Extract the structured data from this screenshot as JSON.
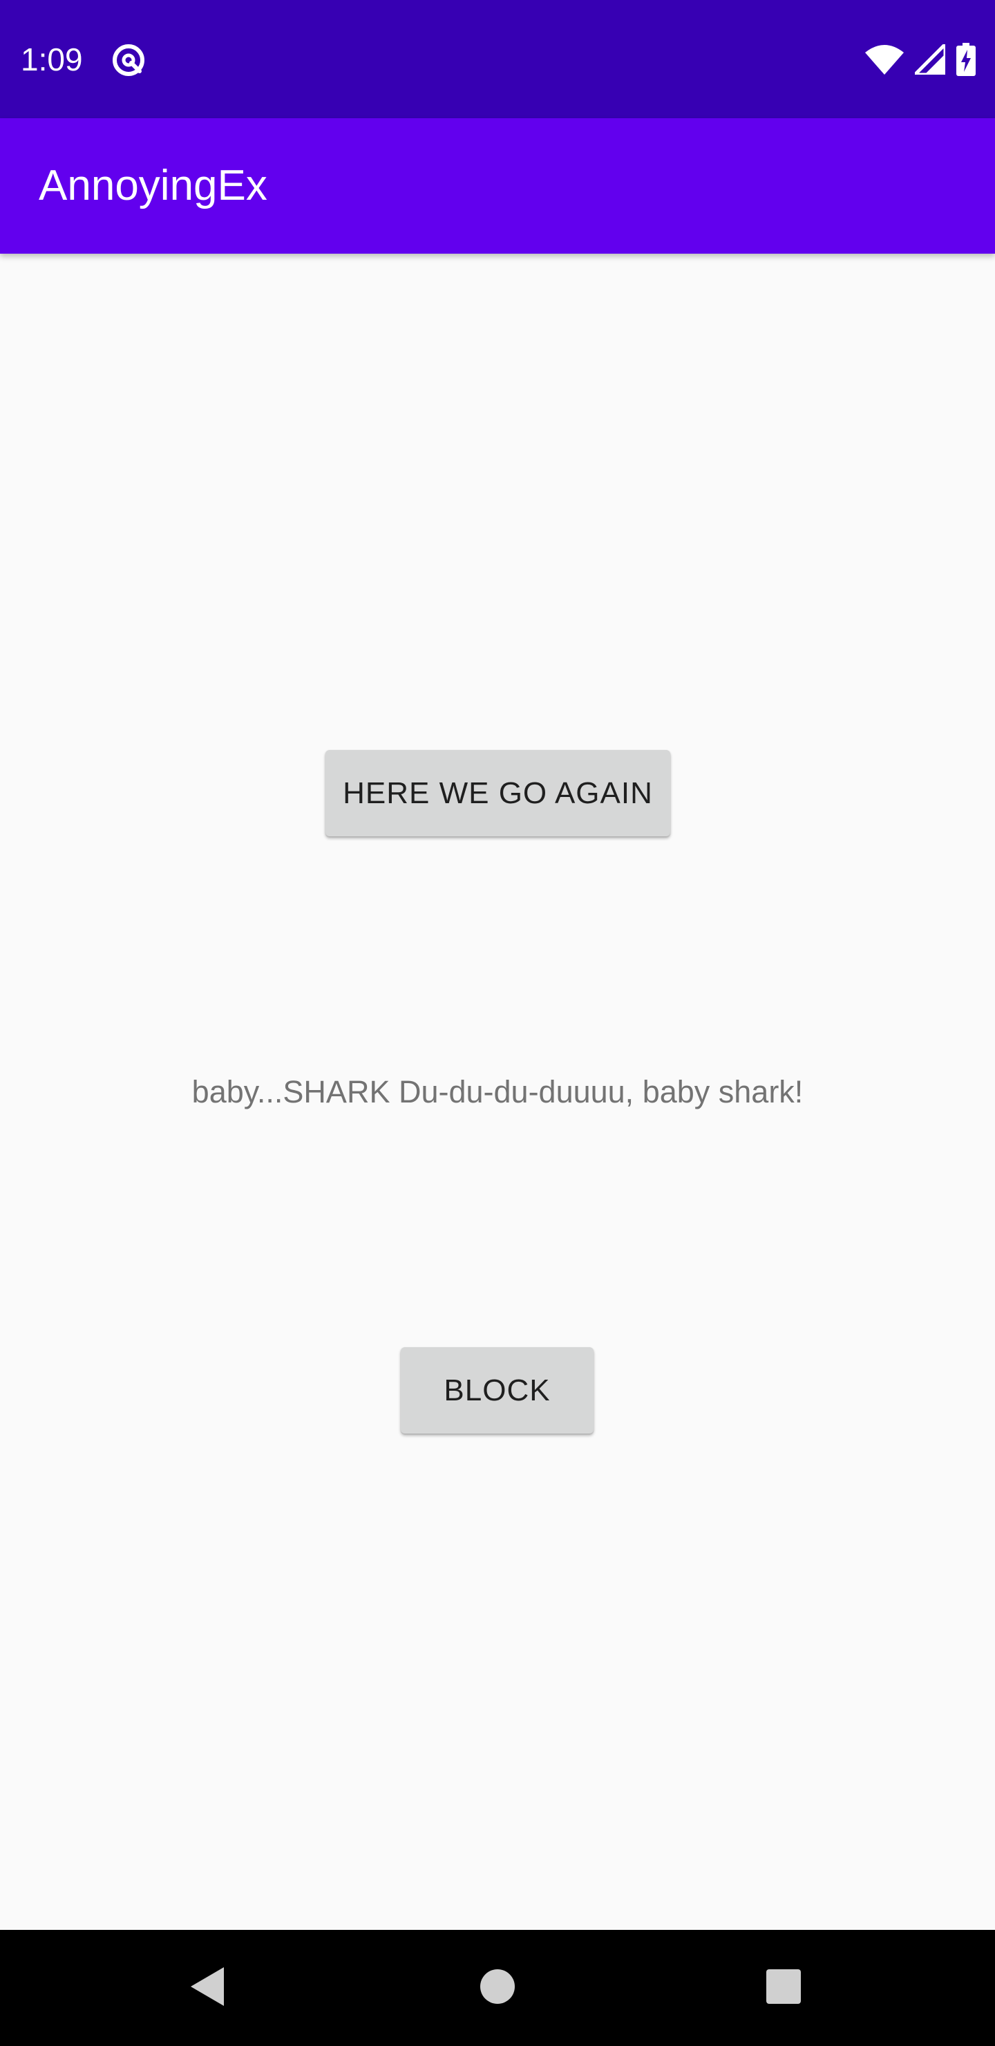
{
  "status_bar": {
    "time": "1:09",
    "background": "#3700b3",
    "icons": [
      "notification-at-icon",
      "wifi-icon",
      "signal-icon",
      "battery-charging-icon"
    ]
  },
  "app_bar": {
    "title": "AnnoyingEx",
    "background": "#6200ee"
  },
  "main": {
    "again_button_label": "HERE WE GO AGAIN",
    "lyric_text": "baby...SHARK Du-du-du-duuuu, baby shark!",
    "block_button_label": "BLOCK",
    "background": "#fafafa",
    "button_color": "#d6d7d7"
  },
  "nav_bar": {
    "icons": [
      "back-icon",
      "home-icon",
      "recents-icon"
    ]
  }
}
